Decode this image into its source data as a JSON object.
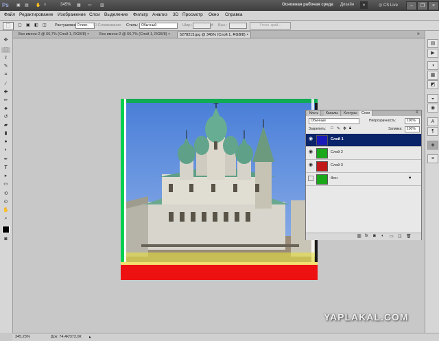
{
  "appbar": {
    "logo": "Ps",
    "zoom": "345%",
    "workspace": "Основная рабочая среда",
    "design": "Дизайн",
    "cslive": "CS Live"
  },
  "menu": [
    "Файл",
    "Редактирование",
    "Изображение",
    "Слои",
    "Выделение",
    "Фильтр",
    "Анализ",
    "3D",
    "Просмотр",
    "Окно",
    "Справка"
  ],
  "options": {
    "feather_label": "Растушевка:",
    "feather_value": "0 пикс.",
    "antialias_label": "Сглаживание",
    "style_label": "Стиль:",
    "style_value": "Обычный",
    "width_label": "Шир.:",
    "height_label": "Выс.:",
    "refine_label": "Уточн. край..."
  },
  "tabs": [
    {
      "label": "Без имени-2 @ 66,7% (Слой 1, RGB/8) ×"
    },
    {
      "label": "Без имени-2 @ 66,7% (Слой 1, RGB/8) ×"
    },
    {
      "label": "5278215.jpg @ 345% (Слой 1, RGB/8) ×"
    }
  ],
  "layers_panel": {
    "tabs": [
      "Кисть",
      "Каналы",
      "Контуры",
      "Слои"
    ],
    "blend_mode": "Обычные",
    "opacity_label": "Непрозрачность:",
    "opacity_value": "100%",
    "lock_label": "Закрепить:",
    "fill_label": "Заливка:",
    "fill_value": "100%",
    "layers": [
      {
        "name": "Слой 1",
        "color": "#1a1ab8",
        "selected": true
      },
      {
        "name": "Слой 2",
        "color": "#1aa81a",
        "selected": false
      },
      {
        "name": "Слой 3",
        "color": "#c01a1a",
        "selected": false
      },
      {
        "name": "Фон",
        "color": "#1aa81a",
        "selected": false
      }
    ]
  },
  "status": {
    "zoom": "345,23%",
    "doc": "Док: 74,4К/372,0К"
  },
  "watermark": "YAPLAKAL.COM"
}
